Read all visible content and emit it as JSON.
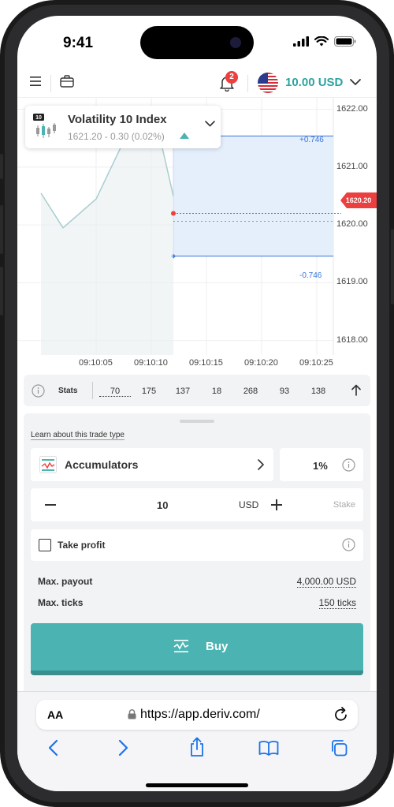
{
  "status_bar": {
    "time": "9:41"
  },
  "header": {
    "notification_count": "2",
    "balance": "10.00 USD"
  },
  "market": {
    "icon_badge": "10",
    "name": "Volatility 10 Index",
    "quote": "1621.20 - 0.30 (0.02%)"
  },
  "chart_data": {
    "type": "line",
    "y_ticks": [
      "1622.00",
      "1621.00",
      "1620.00",
      "1619.00",
      "1618.00"
    ],
    "x_ticks": [
      "09:10:05",
      "09:10:10",
      "09:10:15",
      "09:10:20",
      "09:10:25"
    ],
    "current_price": "1620.20",
    "upper_barrier_label": "+0.746",
    "lower_barrier_label": "-0.746",
    "ylim": [
      1617.75,
      1622.2
    ],
    "barrier_range": [
      1619.46,
      1621.54
    ],
    "series": [
      {
        "x": [
          0,
          2,
          5,
          8,
          10.5,
          12
        ],
        "y": [
          1620.55,
          1619.95,
          1620.45,
          1621.65,
          1621.75,
          1620.5
        ]
      }
    ],
    "colors": {
      "line": "#a9cdd0",
      "area": "#e8eef0",
      "barrier": "#3a77d9",
      "band": "#e5eefb",
      "spot": "#ec3f3f"
    }
  },
  "stats": {
    "label": "Stats",
    "values": [
      "70",
      "175",
      "137",
      "18",
      "268",
      "93",
      "138"
    ]
  },
  "trade": {
    "learn_link": "Learn about this trade type",
    "trade_type": "Accumulators",
    "growth_rate": "1%",
    "stake_value": "10",
    "stake_currency": "USD",
    "stake_label": "Stake",
    "take_profit_label": "Take profit",
    "max_payout_label": "Max. payout",
    "max_payout_value": "4,000.00 USD",
    "max_ticks_label": "Max. ticks",
    "max_ticks_value": "150 ticks",
    "buy_label": "Buy"
  },
  "browser": {
    "text_size_label": "AA",
    "url": "https://app.deriv.com/"
  },
  "colors": {
    "accent": "#4bb4b3",
    "balance": "#2da3a0",
    "badge": "#ec3f3f"
  }
}
